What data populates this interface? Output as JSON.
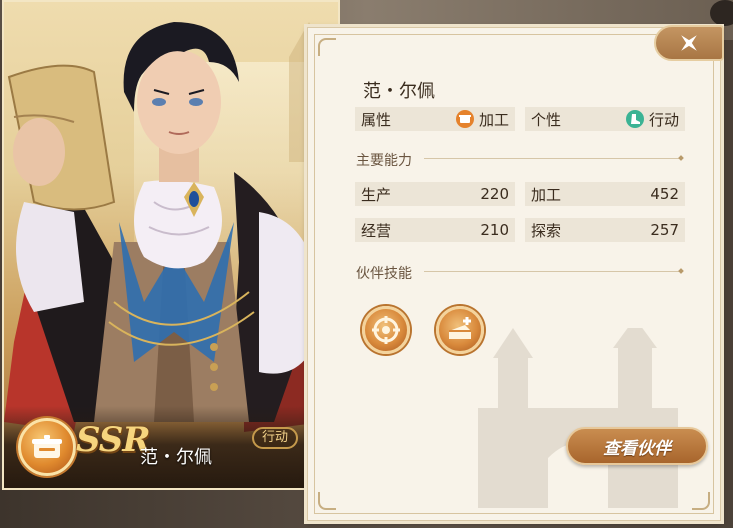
{
  "character": {
    "name": "范・尔佩",
    "rarity": "SSR",
    "trait_badge": "行动"
  },
  "info": {
    "name": "范・尔佩",
    "attribute_label": "属性",
    "attribute_value": "加工",
    "attribute_icon": "pot-icon",
    "personality_label": "个性",
    "personality_value": "行动",
    "personality_icon": "running-boot-icon",
    "abilities_title": "主要能力",
    "abilities": [
      {
        "label": "生产",
        "value": "220"
      },
      {
        "label": "加工",
        "value": "452"
      },
      {
        "label": "经营",
        "value": "210"
      },
      {
        "label": "探索",
        "value": "257"
      }
    ],
    "skills_title": "伙伴技能",
    "skills": [
      {
        "icon": "gear-compass-icon"
      },
      {
        "icon": "cake-plus-icon"
      }
    ]
  },
  "buttons": {
    "close_icon": "close-star-icon",
    "view_partner": "查看伙伴"
  },
  "colors": {
    "panel_bg": "#f8f3e9",
    "accent_orange": "#c98d50",
    "text_dark": "#3a2c1e",
    "rarity_gold": "#f6d57e"
  }
}
